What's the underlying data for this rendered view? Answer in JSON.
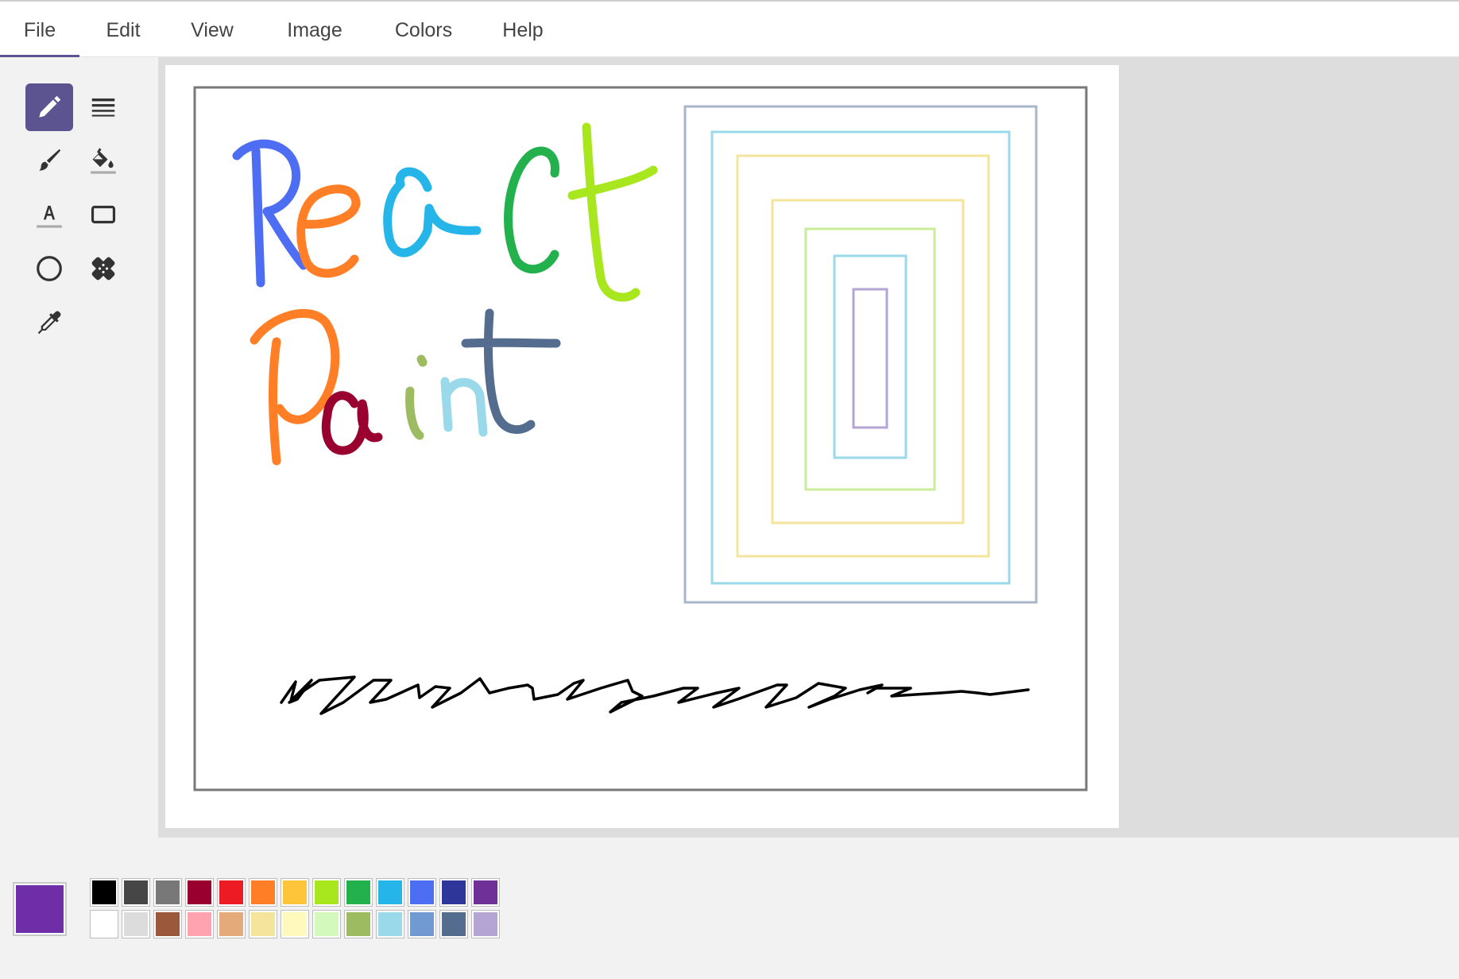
{
  "menu": {
    "items": [
      {
        "label": "File",
        "active": true
      },
      {
        "label": "Edit"
      },
      {
        "label": "View"
      },
      {
        "label": "Image"
      },
      {
        "label": "Colors"
      },
      {
        "label": "Help"
      }
    ]
  },
  "toolbox": {
    "tools": [
      {
        "name": "pencil",
        "icon": "pencil-icon",
        "selected": true
      },
      {
        "name": "line-width",
        "icon": "line-width-icon"
      },
      {
        "name": "brush",
        "icon": "brush-icon"
      },
      {
        "name": "fill",
        "icon": "paint-bucket-icon"
      },
      {
        "name": "text",
        "icon": "text-icon"
      },
      {
        "name": "rectangle",
        "icon": "rectangle-icon"
      },
      {
        "name": "ellipse",
        "icon": "ellipse-icon"
      },
      {
        "name": "eraser",
        "icon": "eraser-icon"
      },
      {
        "name": "picker",
        "icon": "eyedropper-icon"
      }
    ]
  },
  "colors": {
    "current": "#6f2da8",
    "accent": "#5c5491",
    "palette_top": [
      "#000000",
      "#464646",
      "#787878",
      "#990030",
      "#ed1c24",
      "#ff7e26",
      "#ffc53a",
      "#a8e61d",
      "#22b14c",
      "#25b5e8",
      "#4d6df3",
      "#2f3699",
      "#6f3198"
    ],
    "palette_bottom": [
      "#ffffff",
      "#dcdcdc",
      "#9c583b",
      "#ffa3b1",
      "#e5aa7a",
      "#f5e49c",
      "#fff9bd",
      "#d3f9bc",
      "#9dbb61",
      "#99d9ea",
      "#709ad1",
      "#546d8e",
      "#b5a5d5"
    ]
  },
  "canvas": {
    "strokes": [
      {
        "name": "react-text-R",
        "color": "#4d6df3"
      },
      {
        "name": "react-text-e",
        "color": "#ff7e26"
      },
      {
        "name": "react-text-a",
        "color": "#25b5e8"
      },
      {
        "name": "react-text-c",
        "color": "#22b14c"
      },
      {
        "name": "react-text-t",
        "color": "#a8e61d"
      },
      {
        "name": "paint-text-P",
        "color": "#ff7e26"
      },
      {
        "name": "paint-text-a",
        "color": "#990030"
      },
      {
        "name": "paint-text-i",
        "color": "#9dbb61"
      },
      {
        "name": "paint-text-n",
        "color": "#99d9ea"
      },
      {
        "name": "paint-text-t",
        "color": "#546d8e"
      },
      {
        "name": "zigzag-scribble",
        "color": "#000000"
      },
      {
        "name": "frame-rect",
        "color": "#787878"
      }
    ],
    "nested_rect_colors": [
      "#a8b6c9",
      "#99d9ea",
      "#f5e49c",
      "#f5e49c",
      "#c8ec9a",
      "#99d9ea",
      "#b5a5d5"
    ]
  }
}
